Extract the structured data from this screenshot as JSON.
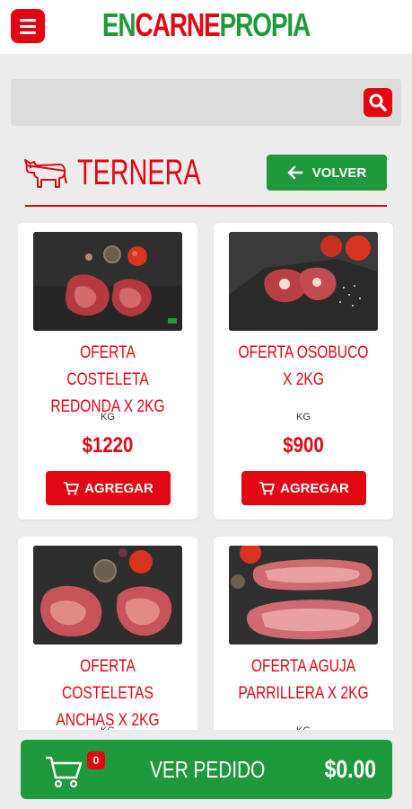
{
  "app": {
    "logo_parts": [
      "EN",
      "CARNE",
      "PROPIA"
    ]
  },
  "search": {
    "placeholder": ""
  },
  "category": {
    "title": "TERNERA",
    "back_label": "VOLVER"
  },
  "products": [
    {
      "name": "OFERTA COSTELETA REDONDA X 2KG",
      "unit": "KG",
      "price": "$1220",
      "button": "AGREGAR"
    },
    {
      "name": "OFERTA OSOBUCO X 2KG",
      "unit": "KG",
      "price": "$900",
      "button": "AGREGAR"
    },
    {
      "name": "OFERTA COSTELETAS ANCHAS X 2KG",
      "unit": "KG",
      "price": "",
      "button": ""
    },
    {
      "name": "OFERTA AGUJA PARRILLERA X 2KG",
      "unit": "KG",
      "price": "",
      "button": ""
    }
  ],
  "footer": {
    "cart_count": "0",
    "label": "VER PEDIDO",
    "total": "$0.00"
  },
  "colors": {
    "brand_red": "#e30613",
    "brand_green": "#1e9a3c",
    "background": "#ececec"
  }
}
